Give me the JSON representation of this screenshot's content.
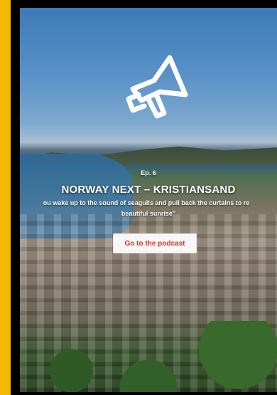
{
  "episode": {
    "label": "Ep. 6",
    "title": "NORWAY NEXT – KRISTIANSAND",
    "quote_line1": "ou wake up to the sound of seagulls and pull back the curtains to re",
    "quote_line2": "beautiful sunrise\"",
    "cta_label": "Go to the podcast",
    "icon": "megaphone-icon"
  },
  "colors": {
    "frame": "#f5b800",
    "cta_text": "#d4382b",
    "cta_bg": "#f7f7f7"
  }
}
